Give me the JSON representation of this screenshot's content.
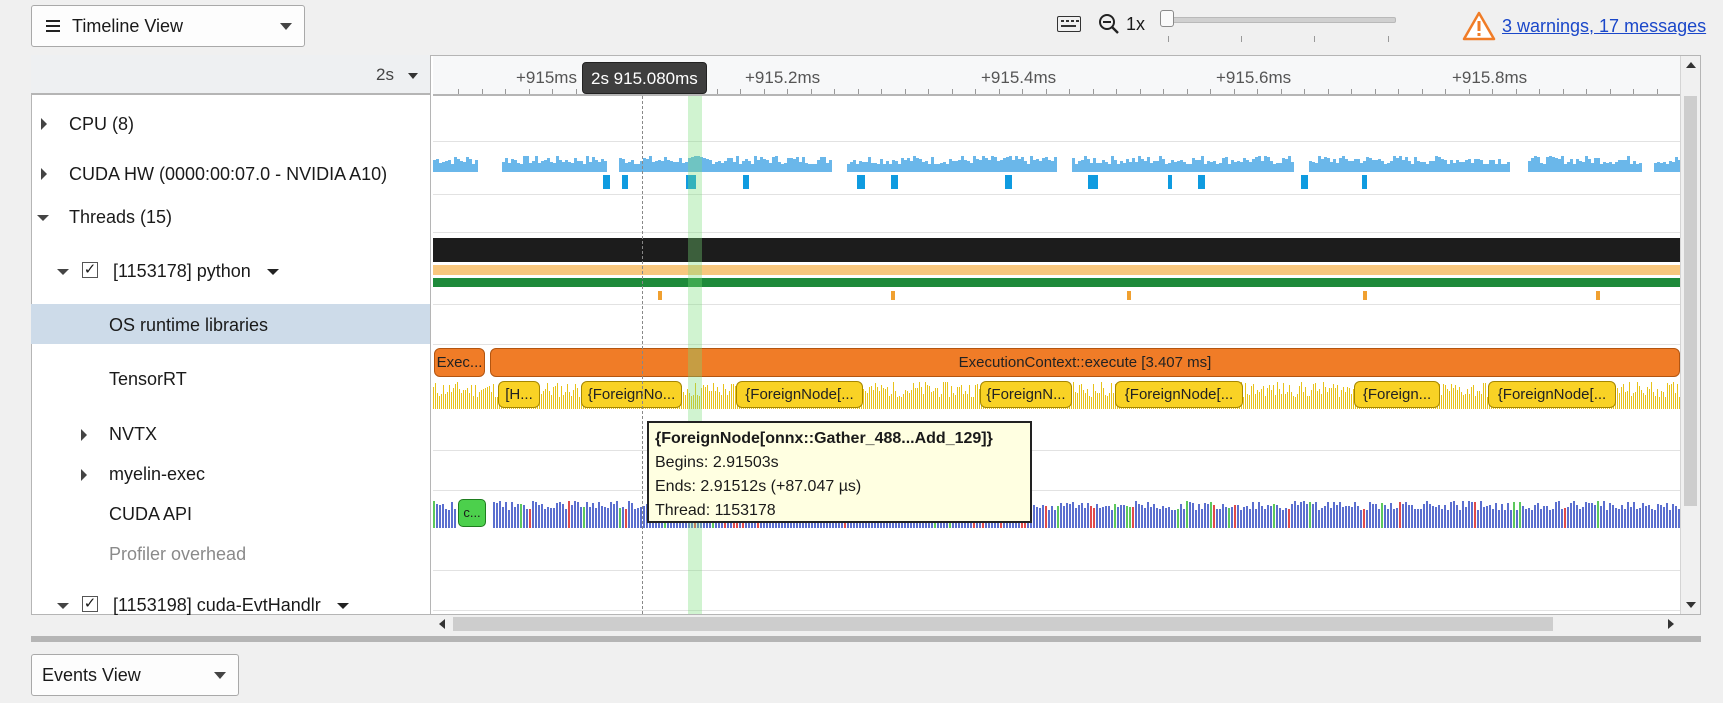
{
  "toolbar": {
    "view_label": "Timeline View",
    "zoom_level": "1x",
    "warnings_link": "3 warnings, 17 messages"
  },
  "timeline": {
    "scale_label": "2s",
    "cursor_time": "2s 915.080ms",
    "ticks": [
      "+915ms",
      "+915.2ms",
      "+915.4ms",
      "+915.6ms",
      "+915.8ms"
    ]
  },
  "rows": {
    "cpu": "CPU (8)",
    "cuda_hw": "CUDA HW (0000:00:07.0 - NVIDIA A10)",
    "threads": "Threads (15)",
    "python": "[1153178] python",
    "os_runtime": "OS runtime libraries",
    "tensorrt": "TensorRT",
    "nvtx": "NVTX",
    "myelin": "myelin-exec",
    "cuda_api": "CUDA API",
    "profiler": "Profiler overhead",
    "evt_handler": "[1153198] cuda-EvtHandlr"
  },
  "tensorrt": {
    "exec_small": "Exec...",
    "exec_main": "ExecutionContext::execute [3.407 ms]",
    "nodes": [
      "[H...",
      "{ForeignNo...",
      "{ForeignNode[...",
      "{ForeignN...",
      "{ForeignNode[...",
      "{Foreign...",
      "{ForeignNode[..."
    ]
  },
  "cuda_api_box": "c...",
  "tooltip": {
    "title": "{ForeignNode[onnx::Gather_488...Add_129]}",
    "begins": "Begins: 2.91503s",
    "ends": "Ends: 2.91512s (+87.047 µs)",
    "thread": "Thread: 1153178"
  },
  "bottom": {
    "events_label": "Events View"
  },
  "colors": {
    "cuda_hw_blue": "#6ab7ea",
    "exec_orange": "#f07c27",
    "node_yellow": "#f9d225",
    "thread_green": "#1e8a3a",
    "thread_band": "#f8c77e",
    "api_blue": "#5b6fcf",
    "api_red": "#e04a4a",
    "api_green": "#5cc85c",
    "selection": "#cddbe9"
  }
}
